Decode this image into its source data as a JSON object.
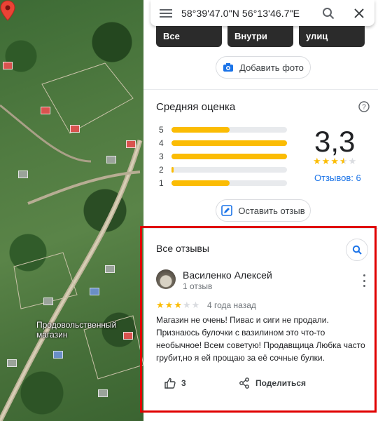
{
  "map": {
    "place_label": "Продовольственный магазин"
  },
  "search": {
    "query": "58°39'47.0\"N 56°13'46.7\"E",
    "icons": {
      "menu": "menu-icon",
      "search": "search-icon",
      "close": "close-icon"
    }
  },
  "photo_tabs": [
    "Все",
    "Внутри",
    "улиц"
  ],
  "add_photo": {
    "label": "Добавить фото",
    "icon": "add-photo-icon"
  },
  "rating": {
    "title": "Средняя оценка",
    "score": "3,3",
    "stars_value": 3.3,
    "reviews_link": "Отзывов: 6",
    "distribution": [
      {
        "stars": "5",
        "fraction": 0.5
      },
      {
        "stars": "4",
        "fraction": 1.0
      },
      {
        "stars": "3",
        "fraction": 1.0
      },
      {
        "stars": "2",
        "fraction": 0.02
      },
      {
        "stars": "1",
        "fraction": 0.5
      }
    ]
  },
  "write_review": {
    "label": "Оставить отзыв",
    "icon": "write-review-icon"
  },
  "reviews": {
    "title": "Все отзывы",
    "items": [
      {
        "author": "Василенко Алексей",
        "author_sub": "1 отзыв",
        "stars": 3,
        "date": "4 года назад",
        "text": "Магазин не очень! Пивас и сиги не продали. Признаюсь булочки с вазилином это что-то необычное! Всем советую! Продавщица Любка часто грубит,но я ей прощаю за её сочные булки.",
        "likes": "3",
        "share_label": "Поделиться"
      }
    ]
  },
  "colors": {
    "accent": "#1a73e8",
    "star": "#fbbc04",
    "highlight_frame": "#e00000",
    "pin": "#ea4335"
  }
}
